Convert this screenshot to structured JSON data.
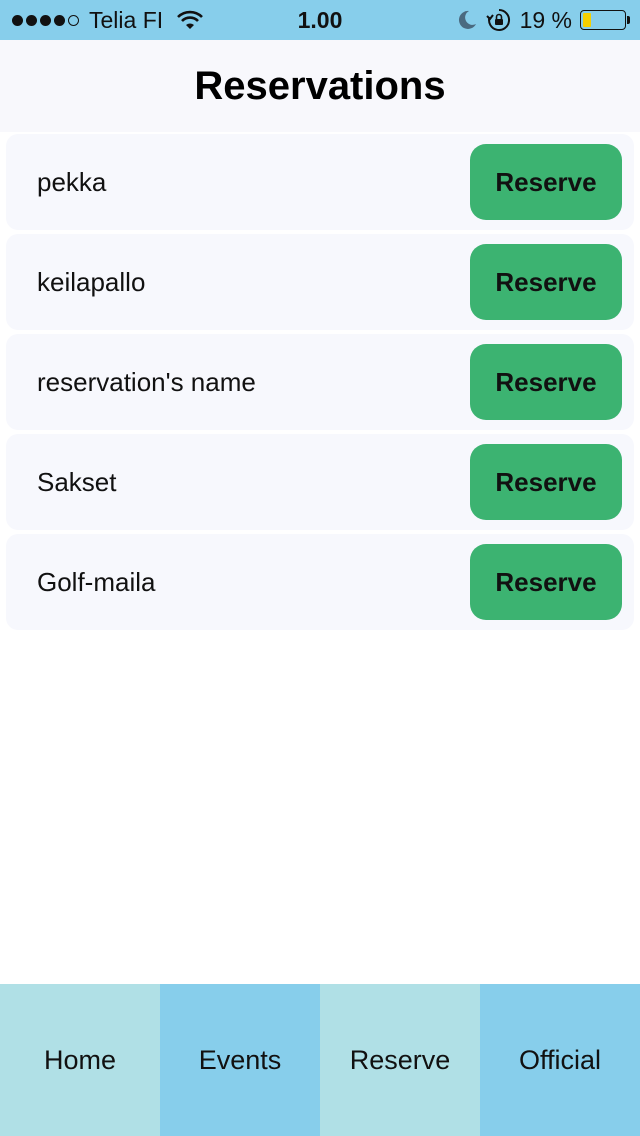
{
  "status_bar": {
    "carrier": "Telia FI",
    "time": "1.00",
    "battery_percent": "19 %",
    "battery_level": 0.19,
    "signal_bars_filled": 4,
    "signal_bars_total": 5,
    "icons": [
      "wifi-icon",
      "moon-icon",
      "rotation-lock-icon",
      "battery-icon"
    ]
  },
  "header": {
    "title": "Reservations"
  },
  "reservations": [
    {
      "name": "pekka",
      "button_label": "Reserve"
    },
    {
      "name": "keilapallo",
      "button_label": "Reserve"
    },
    {
      "name": "reservation's name",
      "button_label": "Reserve"
    },
    {
      "name": "Sakset",
      "button_label": "Reserve"
    },
    {
      "name": "Golf-maila",
      "button_label": "Reserve"
    }
  ],
  "tabs": [
    {
      "label": "Home"
    },
    {
      "label": "Events"
    },
    {
      "label": "Reserve"
    },
    {
      "label": "Official"
    }
  ],
  "colors": {
    "status_bar_bg": "#87ceeb",
    "tab_light": "#b0e0e6",
    "tab_dark": "#87ceeb",
    "button_green": "#3cb371",
    "row_bg": "#f7f8fd",
    "battery_fill": "#f5d000"
  }
}
